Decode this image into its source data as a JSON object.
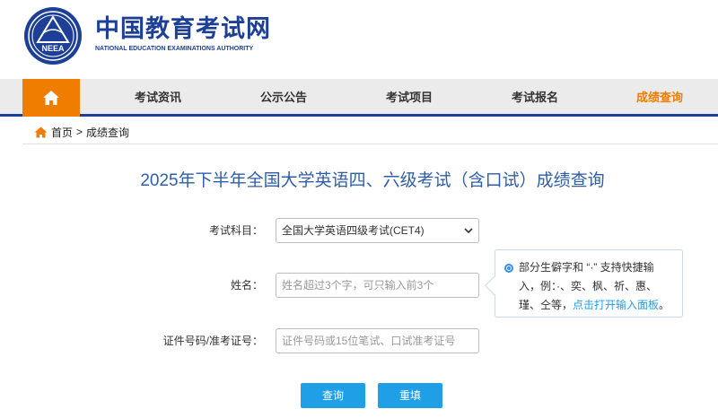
{
  "header": {
    "title": "中国教育考试网",
    "subtitle": "NATIONAL EDUCATION EXAMINATIONS AUTHORITY",
    "logo_text": "NEEA"
  },
  "nav": {
    "home_icon": "home-icon",
    "items": [
      {
        "label": "考试资讯"
      },
      {
        "label": "公示公告"
      },
      {
        "label": "考试项目"
      },
      {
        "label": "考试报名"
      },
      {
        "label": "成绩查询",
        "active": true
      }
    ]
  },
  "breadcrumb": {
    "home": "首页",
    "separator": ">",
    "current": "成绩查询"
  },
  "main": {
    "title": "2025年下半年全国大学英语四、六级考试（含口试）成绩查询",
    "form": {
      "subject_label": "考试科目：",
      "subject_value": "全国大学英语四级考试(CET4)",
      "name_label": "姓名：",
      "name_placeholder": "姓名超过3个字，可只输入前3个",
      "id_label": "证件号码/准考证号：",
      "id_placeholder": "证件号码或15位笔试、口试准考证号"
    },
    "tip": {
      "line1": "部分生僻字和 “·” 支持快捷输",
      "line2": "入，例：·、奕、枫、祈、惠、",
      "line3_prefix": "瑾、仝等，",
      "line3_link": "点击打开输入面板",
      "line3_suffix": "。"
    },
    "buttons": {
      "query": "查询",
      "reset": "重填"
    }
  },
  "colors": {
    "brand_blue": "#1d3f95",
    "accent_orange": "#f07d00",
    "button_blue": "#1e9fe6",
    "title_blue": "#2f5ea8"
  }
}
